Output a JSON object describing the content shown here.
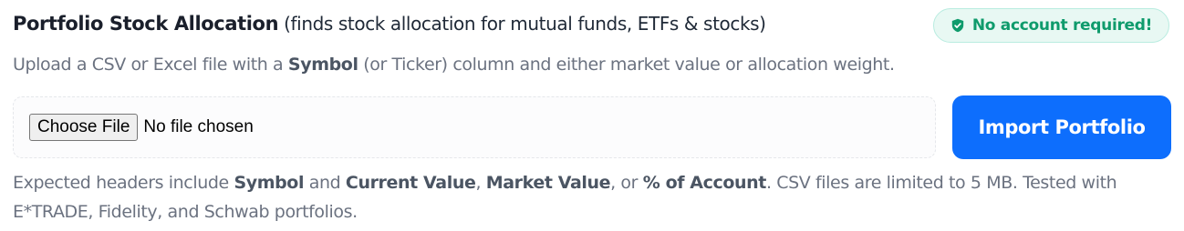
{
  "header": {
    "title": "Portfolio Stock Allocation",
    "subtitle": "(finds stock allocation for mutual funds, ETFs & stocks)"
  },
  "badge": {
    "icon": "shield-check-icon",
    "text": "No account required!",
    "color": "#0f9b6c"
  },
  "instructions": {
    "part1": "Upload a CSV or Excel file with a ",
    "symbol": "Symbol",
    "part2": " (or Ticker) column and either market value or allocation weight."
  },
  "file_input": {
    "button_label": "Choose File",
    "status": "No file chosen"
  },
  "import_button": {
    "label": "Import Portfolio",
    "color": "#0d6efd"
  },
  "notes": {
    "part1": "Expected headers include ",
    "symbol": "Symbol",
    "part2": " and ",
    "current_value": "Current Value",
    "part3": ", ",
    "market_value": "Market Value",
    "part4": ", or ",
    "pct_account": "% of Account",
    "part5": ". CSV files are limited to 5 MB. Tested with E*TRADE, Fidelity, and Schwab portfolios."
  }
}
